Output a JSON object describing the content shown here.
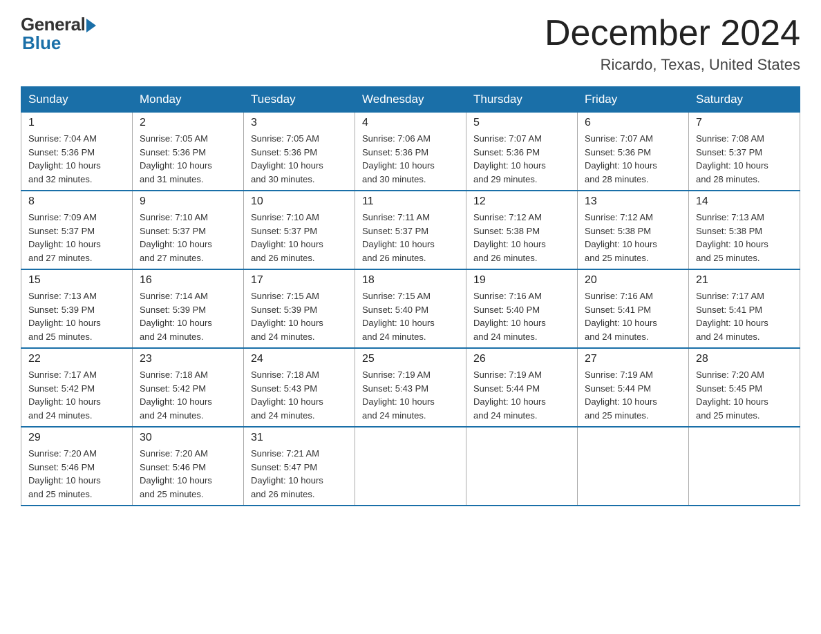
{
  "logo": {
    "general": "General",
    "blue": "Blue"
  },
  "title": "December 2024",
  "location": "Ricardo, Texas, United States",
  "days_of_week": [
    "Sunday",
    "Monday",
    "Tuesday",
    "Wednesday",
    "Thursday",
    "Friday",
    "Saturday"
  ],
  "weeks": [
    [
      {
        "day": "1",
        "info": "Sunrise: 7:04 AM\nSunset: 5:36 PM\nDaylight: 10 hours\nand 32 minutes."
      },
      {
        "day": "2",
        "info": "Sunrise: 7:05 AM\nSunset: 5:36 PM\nDaylight: 10 hours\nand 31 minutes."
      },
      {
        "day": "3",
        "info": "Sunrise: 7:05 AM\nSunset: 5:36 PM\nDaylight: 10 hours\nand 30 minutes."
      },
      {
        "day": "4",
        "info": "Sunrise: 7:06 AM\nSunset: 5:36 PM\nDaylight: 10 hours\nand 30 minutes."
      },
      {
        "day": "5",
        "info": "Sunrise: 7:07 AM\nSunset: 5:36 PM\nDaylight: 10 hours\nand 29 minutes."
      },
      {
        "day": "6",
        "info": "Sunrise: 7:07 AM\nSunset: 5:36 PM\nDaylight: 10 hours\nand 28 minutes."
      },
      {
        "day": "7",
        "info": "Sunrise: 7:08 AM\nSunset: 5:37 PM\nDaylight: 10 hours\nand 28 minutes."
      }
    ],
    [
      {
        "day": "8",
        "info": "Sunrise: 7:09 AM\nSunset: 5:37 PM\nDaylight: 10 hours\nand 27 minutes."
      },
      {
        "day": "9",
        "info": "Sunrise: 7:10 AM\nSunset: 5:37 PM\nDaylight: 10 hours\nand 27 minutes."
      },
      {
        "day": "10",
        "info": "Sunrise: 7:10 AM\nSunset: 5:37 PM\nDaylight: 10 hours\nand 26 minutes."
      },
      {
        "day": "11",
        "info": "Sunrise: 7:11 AM\nSunset: 5:37 PM\nDaylight: 10 hours\nand 26 minutes."
      },
      {
        "day": "12",
        "info": "Sunrise: 7:12 AM\nSunset: 5:38 PM\nDaylight: 10 hours\nand 26 minutes."
      },
      {
        "day": "13",
        "info": "Sunrise: 7:12 AM\nSunset: 5:38 PM\nDaylight: 10 hours\nand 25 minutes."
      },
      {
        "day": "14",
        "info": "Sunrise: 7:13 AM\nSunset: 5:38 PM\nDaylight: 10 hours\nand 25 minutes."
      }
    ],
    [
      {
        "day": "15",
        "info": "Sunrise: 7:13 AM\nSunset: 5:39 PM\nDaylight: 10 hours\nand 25 minutes."
      },
      {
        "day": "16",
        "info": "Sunrise: 7:14 AM\nSunset: 5:39 PM\nDaylight: 10 hours\nand 24 minutes."
      },
      {
        "day": "17",
        "info": "Sunrise: 7:15 AM\nSunset: 5:39 PM\nDaylight: 10 hours\nand 24 minutes."
      },
      {
        "day": "18",
        "info": "Sunrise: 7:15 AM\nSunset: 5:40 PM\nDaylight: 10 hours\nand 24 minutes."
      },
      {
        "day": "19",
        "info": "Sunrise: 7:16 AM\nSunset: 5:40 PM\nDaylight: 10 hours\nand 24 minutes."
      },
      {
        "day": "20",
        "info": "Sunrise: 7:16 AM\nSunset: 5:41 PM\nDaylight: 10 hours\nand 24 minutes."
      },
      {
        "day": "21",
        "info": "Sunrise: 7:17 AM\nSunset: 5:41 PM\nDaylight: 10 hours\nand 24 minutes."
      }
    ],
    [
      {
        "day": "22",
        "info": "Sunrise: 7:17 AM\nSunset: 5:42 PM\nDaylight: 10 hours\nand 24 minutes."
      },
      {
        "day": "23",
        "info": "Sunrise: 7:18 AM\nSunset: 5:42 PM\nDaylight: 10 hours\nand 24 minutes."
      },
      {
        "day": "24",
        "info": "Sunrise: 7:18 AM\nSunset: 5:43 PM\nDaylight: 10 hours\nand 24 minutes."
      },
      {
        "day": "25",
        "info": "Sunrise: 7:19 AM\nSunset: 5:43 PM\nDaylight: 10 hours\nand 24 minutes."
      },
      {
        "day": "26",
        "info": "Sunrise: 7:19 AM\nSunset: 5:44 PM\nDaylight: 10 hours\nand 24 minutes."
      },
      {
        "day": "27",
        "info": "Sunrise: 7:19 AM\nSunset: 5:44 PM\nDaylight: 10 hours\nand 25 minutes."
      },
      {
        "day": "28",
        "info": "Sunrise: 7:20 AM\nSunset: 5:45 PM\nDaylight: 10 hours\nand 25 minutes."
      }
    ],
    [
      {
        "day": "29",
        "info": "Sunrise: 7:20 AM\nSunset: 5:46 PM\nDaylight: 10 hours\nand 25 minutes."
      },
      {
        "day": "30",
        "info": "Sunrise: 7:20 AM\nSunset: 5:46 PM\nDaylight: 10 hours\nand 25 minutes."
      },
      {
        "day": "31",
        "info": "Sunrise: 7:21 AM\nSunset: 5:47 PM\nDaylight: 10 hours\nand 26 minutes."
      },
      {
        "day": "",
        "info": ""
      },
      {
        "day": "",
        "info": ""
      },
      {
        "day": "",
        "info": ""
      },
      {
        "day": "",
        "info": ""
      }
    ]
  ]
}
